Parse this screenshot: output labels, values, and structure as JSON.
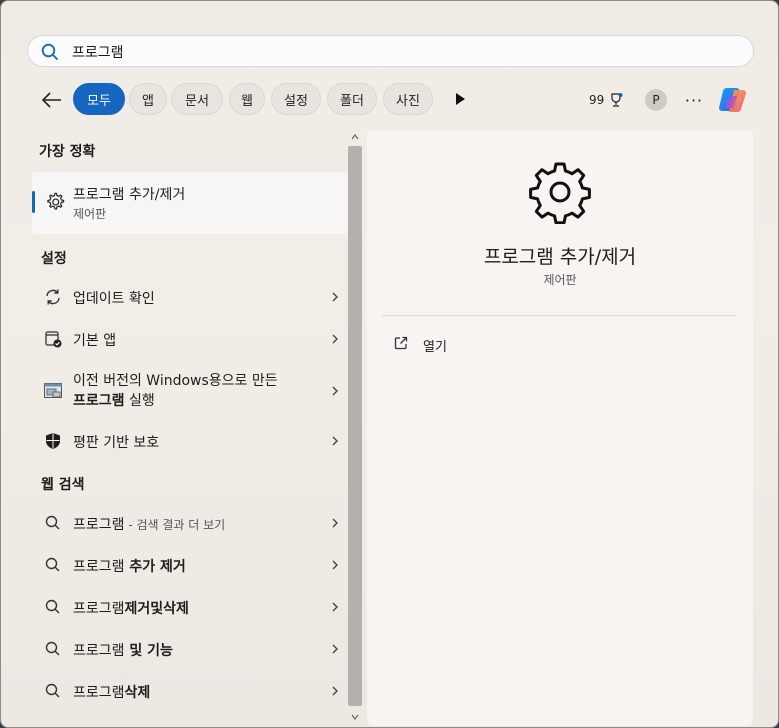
{
  "search": {
    "value": "프로그램"
  },
  "filters": {
    "chips": [
      {
        "label": "모두",
        "active": true
      },
      {
        "label": "앱"
      },
      {
        "label": "문서"
      },
      {
        "label": "웹"
      },
      {
        "label": "설정"
      },
      {
        "label": "폴더"
      },
      {
        "label": "사진"
      }
    ],
    "points": "99",
    "avatar_initial": "P",
    "more_label": "···"
  },
  "best_match": {
    "section_title": "가장 정확",
    "title": "프로그램 추가/제거",
    "subtitle": "제어판"
  },
  "settings": {
    "section_title": "설정",
    "items": [
      {
        "label": "업데이트 확인",
        "icon": "refresh-icon"
      },
      {
        "label": "기본 앱",
        "icon": "default-apps-icon"
      },
      {
        "label_line1": "이전 버전의 Windows용으로 만든",
        "label_line2_bold": "프로그램",
        "label_line2_rest": " 실행",
        "icon": "compatibility-icon"
      },
      {
        "label": "평판 기반 보호",
        "icon": "shield-icon"
      }
    ]
  },
  "web_search": {
    "section_title": "웹 검색",
    "items": [
      {
        "label": "프로그램",
        "suffix": " - 검색 결과 더 보기"
      },
      {
        "bold": "프로그램",
        "rest": " 추가 제거"
      },
      {
        "bold": "프로그램",
        "rest": "제거및삭제"
      },
      {
        "bold": "프로그램",
        "rest": " 및 기능"
      },
      {
        "bold": "프로그램",
        "rest": "삭제"
      }
    ]
  },
  "preview": {
    "title": "프로그램 추가/제거",
    "subtitle": "제어판",
    "actions": [
      {
        "label": "열기",
        "icon": "open-external-icon"
      }
    ]
  },
  "colors": {
    "accent": "#1466c0"
  }
}
